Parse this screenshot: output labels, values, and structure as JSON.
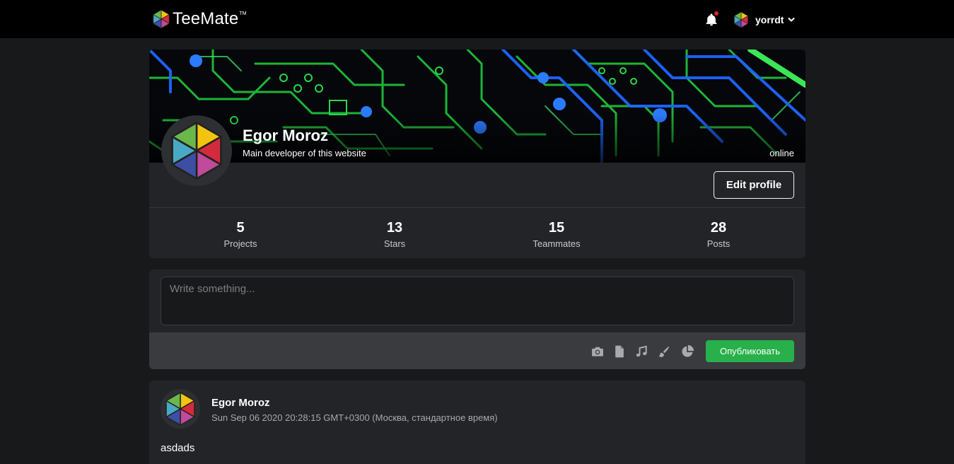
{
  "brand": {
    "name": "TeeMate",
    "tm": "TM"
  },
  "nav": {
    "username": "yorrdt",
    "notification_dot_color": "#e0252b"
  },
  "profile": {
    "name": "Egor Moroz",
    "bio": "Main developer of this website",
    "status": "online",
    "edit_label": "Edit profile",
    "stats": [
      {
        "value": "5",
        "label": "Projects"
      },
      {
        "value": "13",
        "label": "Stars"
      },
      {
        "value": "15",
        "label": "Teammates"
      },
      {
        "value": "28",
        "label": "Posts"
      }
    ]
  },
  "composer": {
    "placeholder": "Write something...",
    "value": "",
    "tools": [
      "camera-icon",
      "file-icon",
      "music-icon",
      "brush-icon",
      "pie-chart-icon"
    ],
    "publish_label": "Опубликовать",
    "publish_color": "#28b04a"
  },
  "posts": [
    {
      "author": "Egor Moroz",
      "date": "Sun Sep 06 2020 20:28:15 GMT+0300 (Москва, стандартное время)",
      "text": "asdads"
    }
  ],
  "logo_colors": [
    "#f2c40f",
    "#d42a3d",
    "#c04a9b",
    "#3d4fa3",
    "#49a9c4",
    "#6ab74a"
  ]
}
